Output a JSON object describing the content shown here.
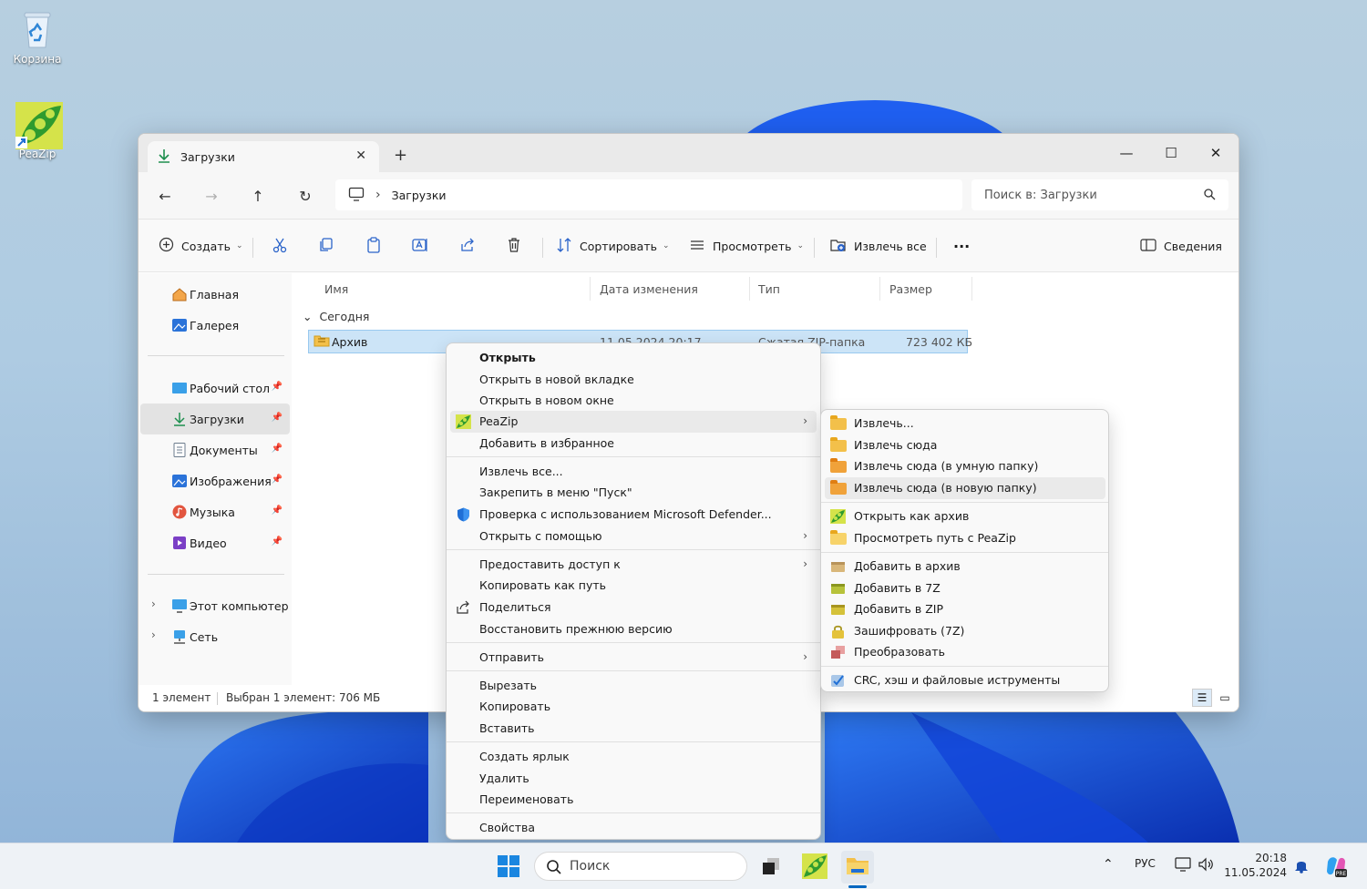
{
  "desktop": {
    "icons": [
      {
        "label": "Корзина"
      },
      {
        "label": "PeaZip"
      }
    ]
  },
  "window": {
    "tab_title": "Загрузки",
    "breadcrumb": "Загрузки",
    "search_placeholder": "Поиск в: Загрузки",
    "toolbar": {
      "create": "Создать",
      "sort": "Сортировать",
      "view": "Просмотреть",
      "extract_all": "Извлечь все",
      "details": "Сведения"
    },
    "nav": {
      "home": "Главная",
      "gallery": "Галерея",
      "desktop": "Рабочий стол",
      "downloads": "Загрузки",
      "documents": "Документы",
      "images": "Изображения",
      "music": "Музыка",
      "video": "Видео",
      "this_pc": "Этот компьютер",
      "network": "Сеть"
    },
    "columns": {
      "name": "Имя",
      "date": "Дата изменения",
      "type": "Тип",
      "size": "Размер"
    },
    "group": "Сегодня",
    "file": {
      "name": "Архив",
      "date": "11.05.2024 20:17",
      "type": "Сжатая ZIP-папка",
      "size": "723 402 КБ"
    },
    "status": {
      "count": "1 элемент",
      "selected": "Выбран 1 элемент: 706 МБ"
    }
  },
  "context_menu": {
    "items": [
      "Открыть",
      "Открыть в новой вкладке",
      "Открыть в новом окне",
      "PeaZip",
      "Добавить в избранное",
      "Извлечь все...",
      "Закрепить в меню \"Пуск\"",
      "Проверка с использованием Microsoft Defender...",
      "Открыть с помощью",
      "Предоставить доступ к",
      "Копировать как путь",
      "Поделиться",
      "Восстановить прежнюю версию",
      "Отправить",
      "Вырезать",
      "Копировать",
      "Вставить",
      "Создать ярлык",
      "Удалить",
      "Переименовать",
      "Свойства"
    ]
  },
  "peazip_menu": {
    "items": [
      "Извлечь...",
      "Извлечь сюда",
      "Извлечь сюда (в умную папку)",
      "Извлечь сюда (в новую папку)",
      "Открыть как архив",
      "Просмотреть путь с PeaZip",
      "Добавить в архив",
      "Добавить в 7Z",
      "Добавить в ZIP",
      "Зашифровать (7Z)",
      "Преобразовать",
      "CRC, хэш и файловые иструменты"
    ]
  },
  "taskbar": {
    "search": "Поиск",
    "lang": "РУС",
    "time": "20:18",
    "date": "11.05.2024"
  },
  "colors": {
    "accent": "#0067c0",
    "selection": "#cce4f7"
  }
}
